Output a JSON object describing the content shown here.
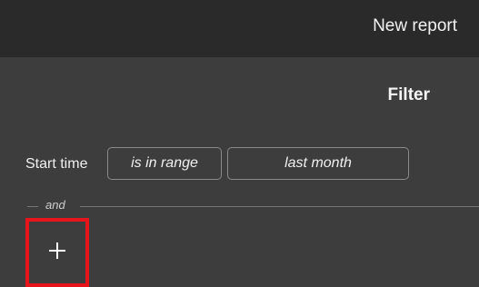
{
  "header": {
    "action_label": "New report"
  },
  "panel": {
    "title": "Filter"
  },
  "filter": {
    "field_label": "Start time",
    "operator": "is in range",
    "value": "last month"
  },
  "connector": {
    "label": "and"
  },
  "add_filter": {
    "icon": "plus-icon",
    "highlight_color": "#e8141b"
  },
  "colors": {
    "background": "#3d3d3d",
    "topbar": "#2a2a2a"
  }
}
